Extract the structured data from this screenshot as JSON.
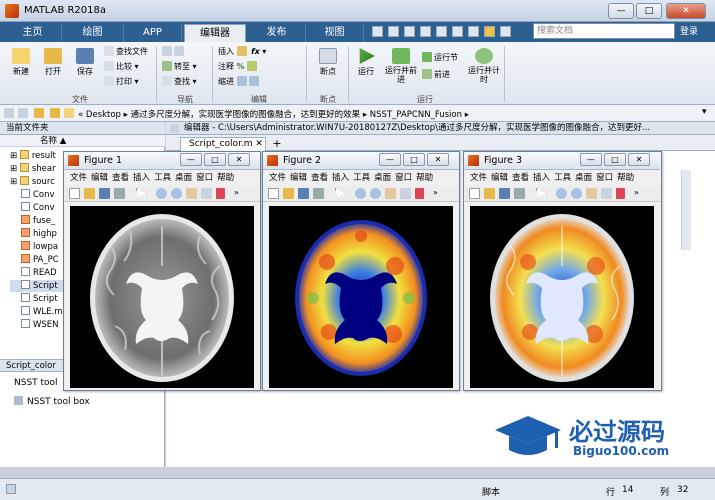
{
  "window": {
    "title": "MATLAB R2018a",
    "min": "—",
    "max": "□",
    "close": "✕"
  },
  "tabs": [
    {
      "label": "主页"
    },
    {
      "label": "绘图"
    },
    {
      "label": "APP"
    },
    {
      "label": "编辑器"
    },
    {
      "label": "发布"
    },
    {
      "label": "视图"
    }
  ],
  "search": {
    "placeholder": "搜索文档"
  },
  "login": "登录",
  "ribbon": {
    "new": "新建",
    "open": "打开",
    "save": "保存",
    "find_files": "查找文件",
    "compare": "比较",
    "print": "打印",
    "goto": "转至",
    "find": "查找",
    "insert": "插入",
    "comment": "注释",
    "indent": "缩进",
    "breakpoints": "断点",
    "run": "运行",
    "run_advance": "运行并前进",
    "run_section": "运行节",
    "advance": "前进",
    "run_time": "运行并计时",
    "groups": {
      "file": "文件",
      "nav": "导航",
      "edit": "编辑",
      "bp": "断点",
      "run": "运行"
    }
  },
  "address": {
    "path": "« Desktop ▸ 通过多尺度分解，实现医学图像的图像融合，达到更好的效果 ▸ NSST_PAPCNN_Fusion ▸"
  },
  "current_folder": {
    "header": "当前文件夹",
    "col_name": "名称 ▲",
    "files": [
      {
        "name": "result",
        "type": "folder"
      },
      {
        "name": "shear",
        "type": "folder"
      },
      {
        "name": "sourc",
        "type": "folder"
      },
      {
        "name": "Conv",
        "type": "m"
      },
      {
        "name": "Conv",
        "type": "m"
      },
      {
        "name": "fuse_",
        "type": "m"
      },
      {
        "name": "highp",
        "type": "m"
      },
      {
        "name": "lowpa",
        "type": "m"
      },
      {
        "name": "PA_PC",
        "type": "m"
      },
      {
        "name": "READ",
        "type": "txt"
      },
      {
        "name": "Script",
        "type": "m"
      },
      {
        "name": "Script",
        "type": "m"
      },
      {
        "name": "WLE.m",
        "type": "m"
      },
      {
        "name": "WSEN",
        "type": "m"
      }
    ]
  },
  "details": {
    "header": "Script_color",
    "item1": "NSST tool",
    "item2": "NSST tool box"
  },
  "editor": {
    "header": "编辑器 - C:\\Users\\Administrator.WIN7U-20180127Z\\Desktop\\通过多尺度分解，实现医学图像的图像融合，达到更好...",
    "tab": "Script_color.m ✕",
    "plus": "+"
  },
  "status": {
    "mode": "脚本",
    "row_label": "行",
    "row": "14",
    "col_label": "列",
    "col": "32"
  },
  "figure_menu": [
    "文件",
    "编辑",
    "查看",
    "插入",
    "工具",
    "桌面",
    "窗口",
    "帮助"
  ],
  "figures": [
    {
      "title": "Figure 1"
    },
    {
      "title": "Figure 2"
    },
    {
      "title": "Figure 3"
    }
  ],
  "watermark": {
    "text": "必过源码",
    "url": "Biguo100.com"
  }
}
